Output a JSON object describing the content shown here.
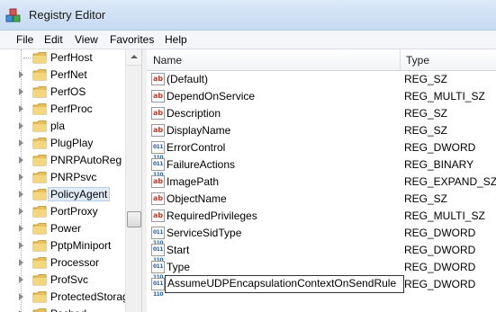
{
  "window": {
    "title": "Registry Editor"
  },
  "menu": [
    "File",
    "Edit",
    "View",
    "Favorites",
    "Help"
  ],
  "tree": {
    "items": [
      {
        "label": "PerfHost",
        "expandable": false,
        "selected": false
      },
      {
        "label": "PerfNet",
        "expandable": true,
        "selected": false
      },
      {
        "label": "PerfOS",
        "expandable": true,
        "selected": false
      },
      {
        "label": "PerfProc",
        "expandable": true,
        "selected": false
      },
      {
        "label": "pla",
        "expandable": true,
        "selected": false
      },
      {
        "label": "PlugPlay",
        "expandable": true,
        "selected": false
      },
      {
        "label": "PNRPAutoReg",
        "expandable": true,
        "selected": false
      },
      {
        "label": "PNRPsvc",
        "expandable": true,
        "selected": false
      },
      {
        "label": "PolicyAgent",
        "expandable": true,
        "selected": true
      },
      {
        "label": "PortProxy",
        "expandable": true,
        "selected": false
      },
      {
        "label": "Power",
        "expandable": true,
        "selected": false
      },
      {
        "label": "PptpMiniport",
        "expandable": true,
        "selected": false
      },
      {
        "label": "Processor",
        "expandable": true,
        "selected": false
      },
      {
        "label": "ProfSvc",
        "expandable": true,
        "selected": false
      },
      {
        "label": "ProtectedStorage",
        "expandable": true,
        "selected": false
      },
      {
        "label": "Psched",
        "expandable": true,
        "selected": false
      }
    ]
  },
  "list": {
    "columns": {
      "name": "Name",
      "type": "Type"
    },
    "rows": [
      {
        "icon": "string-value-icon",
        "name": "(Default)",
        "type": "REG_SZ"
      },
      {
        "icon": "string-value-icon",
        "name": "DependOnService",
        "type": "REG_MULTI_SZ"
      },
      {
        "icon": "string-value-icon",
        "name": "Description",
        "type": "REG_SZ"
      },
      {
        "icon": "string-value-icon",
        "name": "DisplayName",
        "type": "REG_SZ"
      },
      {
        "icon": "binary-value-icon",
        "name": "ErrorControl",
        "type": "REG_DWORD"
      },
      {
        "icon": "binary-value-icon",
        "name": "FailureActions",
        "type": "REG_BINARY"
      },
      {
        "icon": "string-value-icon",
        "name": "ImagePath",
        "type": "REG_EXPAND_SZ"
      },
      {
        "icon": "string-value-icon",
        "name": "ObjectName",
        "type": "REG_SZ"
      },
      {
        "icon": "string-value-icon",
        "name": "RequiredPrivileges",
        "type": "REG_MULTI_SZ"
      },
      {
        "icon": "binary-value-icon",
        "name": "ServiceSidType",
        "type": "REG_DWORD"
      },
      {
        "icon": "binary-value-icon",
        "name": "Start",
        "type": "REG_DWORD"
      },
      {
        "icon": "binary-value-icon",
        "name": "Type",
        "type": "REG_DWORD"
      }
    ],
    "editing_row": {
      "icon": "binary-value-icon",
      "name": "AssumeUDPEncapsulationContextOnSendRule",
      "type": "REG_DWORD"
    }
  },
  "icons": {
    "string": "ab",
    "binary": "011 110"
  },
  "colors": {
    "folder": "#e8c15c",
    "selection": "#e2ecf8",
    "titlebar": "#c6daf1"
  }
}
